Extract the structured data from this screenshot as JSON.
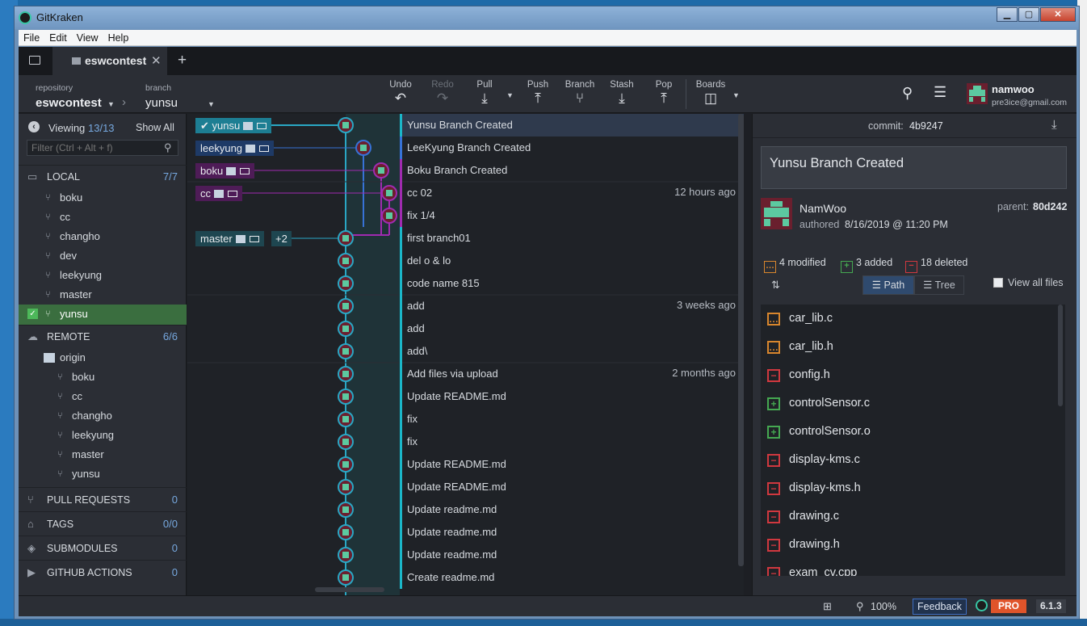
{
  "window": {
    "title": "GitKraken"
  },
  "menu": [
    "File",
    "Edit",
    "View",
    "Help"
  ],
  "tab": {
    "name": "eswcontest"
  },
  "toolbar": {
    "repo_label": "repository",
    "repo_name": "eswcontest",
    "branch_label": "branch",
    "branch_name": "yunsu",
    "undo": "Undo",
    "redo": "Redo",
    "pull": "Pull",
    "push": "Push",
    "branch": "Branch",
    "stash": "Stash",
    "pop": "Pop",
    "boards": "Boards"
  },
  "user": {
    "name": "namwoo",
    "email": "pre3ice@gmail.com"
  },
  "sidebar": {
    "viewing_label": "Viewing",
    "viewing_count": "13/13",
    "show_all": "Show All",
    "filter_placeholder": "Filter (Ctrl + Alt + f)",
    "local": {
      "title": "LOCAL",
      "count": "7/7"
    },
    "local_branches": [
      "boku",
      "cc",
      "changho",
      "dev",
      "leekyung",
      "master",
      "yunsu"
    ],
    "remote": {
      "title": "REMOTE",
      "count": "6/6"
    },
    "remote_name": "origin",
    "remote_branches": [
      "boku",
      "cc",
      "changho",
      "leekyung",
      "master",
      "yunsu"
    ],
    "pull_requests": {
      "title": "PULL REQUESTS",
      "count": "0"
    },
    "tags": {
      "title": "TAGS",
      "count": "0/0"
    },
    "submodules": {
      "title": "SUBMODULES",
      "count": "0"
    },
    "github_actions": {
      "title": "GITHUB ACTIONS",
      "count": "0"
    }
  },
  "graph": {
    "refs": {
      "yunsu": "yunsu",
      "leekyung": "leekyung",
      "boku": "boku",
      "cc": "cc",
      "master": "master",
      "more": "+2"
    },
    "commits": [
      {
        "msg": "Yunsu Branch Created",
        "when": ""
      },
      {
        "msg": "LeeKyung Branch Created",
        "when": ""
      },
      {
        "msg": "Boku Branch Created",
        "when": ""
      },
      {
        "msg": "cc 02",
        "when": "12 hours ago"
      },
      {
        "msg": "fix 1/4",
        "when": ""
      },
      {
        "msg": "first branch01",
        "when": ""
      },
      {
        "msg": "del o & lo",
        "when": ""
      },
      {
        "msg": "code name 815",
        "when": ""
      },
      {
        "msg": "add",
        "when": "3 weeks ago"
      },
      {
        "msg": "add",
        "when": ""
      },
      {
        "msg": "add\\",
        "when": ""
      },
      {
        "msg": "Add files via upload",
        "when": "2 months ago"
      },
      {
        "msg": "Update README.md",
        "when": ""
      },
      {
        "msg": "fix",
        "when": ""
      },
      {
        "msg": "fix",
        "when": ""
      },
      {
        "msg": "Update README.md",
        "when": ""
      },
      {
        "msg": "Update README.md",
        "when": ""
      },
      {
        "msg": "Update readme.md",
        "when": ""
      },
      {
        "msg": "Update readme.md",
        "when": ""
      },
      {
        "msg": "Update readme.md",
        "when": ""
      },
      {
        "msg": "Create readme.md",
        "when": ""
      }
    ]
  },
  "panel": {
    "commit_label": "commit:",
    "commit_hash": "4b9247",
    "message": "Yunsu Branch Created",
    "author": "NamWoo",
    "authored_label": "authored",
    "authored_date": "8/16/2019 @ 11:20 PM",
    "parent_label": "parent:",
    "parent_hash": "80d242",
    "modified": "4 modified",
    "added": "3 added",
    "deleted": "18 deleted",
    "path_label": "Path",
    "tree_label": "Tree",
    "view_all": "View all files",
    "files": [
      {
        "name": "car_lib.c",
        "status": "modified"
      },
      {
        "name": "car_lib.h",
        "status": "modified"
      },
      {
        "name": "config.h",
        "status": "deleted"
      },
      {
        "name": "controlSensor.c",
        "status": "added"
      },
      {
        "name": "controlSensor.o",
        "status": "added"
      },
      {
        "name": "display-kms.c",
        "status": "deleted"
      },
      {
        "name": "display-kms.h",
        "status": "deleted"
      },
      {
        "name": "drawing.c",
        "status": "deleted"
      },
      {
        "name": "drawing.h",
        "status": "deleted"
      },
      {
        "name": "exam_cv.cpp",
        "status": "deleted"
      }
    ]
  },
  "status": {
    "zoom": "100%",
    "feedback": "Feedback",
    "pro": "PRO",
    "version": "6.1.3"
  },
  "colors": {
    "accent_cyan": "#1bb7c9",
    "purple": "#a02bb0",
    "blue": "#3772d6",
    "modified": "#d8862d",
    "added": "#45a851",
    "deleted": "#d0383f",
    "active_branch": "#3a6e3f"
  }
}
